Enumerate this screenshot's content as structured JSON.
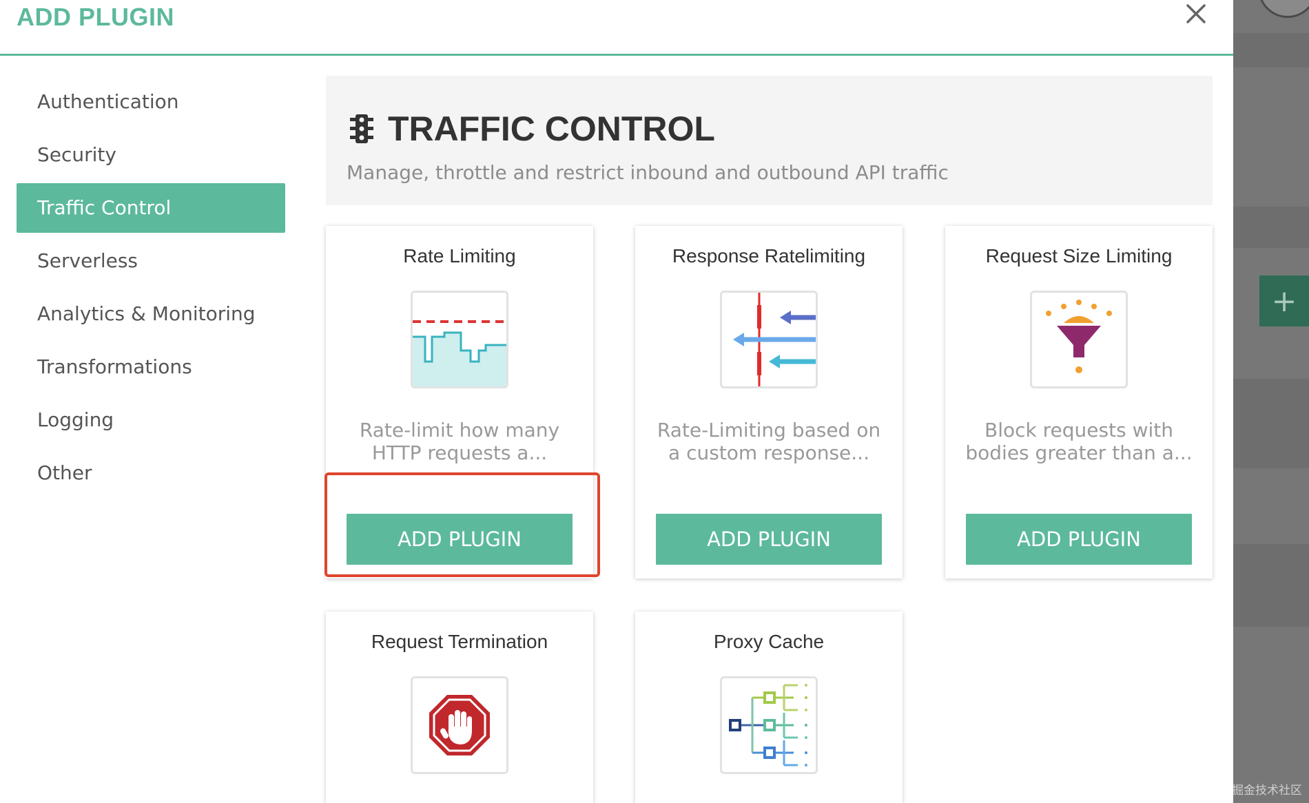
{
  "modal": {
    "title": "ADD PLUGIN",
    "close_icon": "close-icon"
  },
  "sidebar": {
    "items": [
      {
        "label": "Authentication",
        "active": false
      },
      {
        "label": "Security",
        "active": false
      },
      {
        "label": "Traffic Control",
        "active": true
      },
      {
        "label": "Serverless",
        "active": false
      },
      {
        "label": "Analytics & Monitoring",
        "active": false
      },
      {
        "label": "Transformations",
        "active": false
      },
      {
        "label": "Logging",
        "active": false
      },
      {
        "label": "Other",
        "active": false
      }
    ]
  },
  "section": {
    "icon": "traffic-light-icon",
    "title": "TRAFFIC CONTROL",
    "description": "Manage, throttle and restrict inbound and outbound API traffic"
  },
  "plugins": [
    {
      "title": "Rate Limiting",
      "icon": "rate-limit-chart-icon",
      "description": "Rate-limit how many HTTP requests a...",
      "button": "ADD PLUGIN"
    },
    {
      "title": "Response Ratelimiting",
      "icon": "response-arrows-icon",
      "description": "Rate-Limiting based on a custom response...",
      "button": "ADD PLUGIN"
    },
    {
      "title": "Request Size Limiting",
      "icon": "funnel-icon",
      "description": "Block requests with bodies greater than a...",
      "button": "ADD PLUGIN"
    },
    {
      "title": "Request Termination",
      "icon": "stop-hand-icon"
    },
    {
      "title": "Proxy Cache",
      "icon": "cache-tree-icon"
    }
  ],
  "background": {
    "plus_label": "+",
    "watermark": "@稀土掘金技术社区"
  },
  "colors": {
    "accent": "#5cb99c",
    "highlight": "#e0442d",
    "text_dark": "#333333",
    "text_muted": "#999999"
  }
}
